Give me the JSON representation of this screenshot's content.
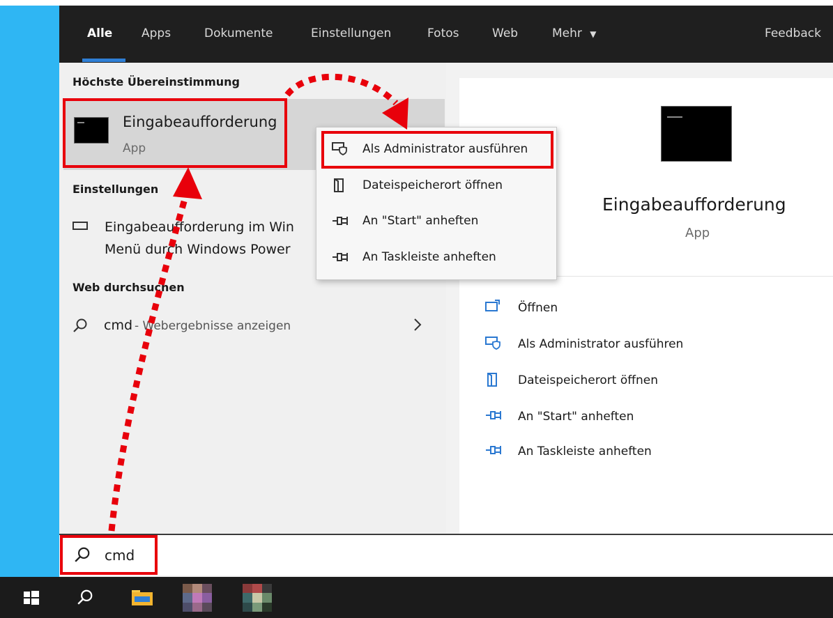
{
  "colors": {
    "accent": "#2f7fd6",
    "highlight": "#e8000b",
    "desktop": "#2fb6f3",
    "topbar": "#1f1f1f",
    "taskbar": "#1b1b1b"
  },
  "tabs": [
    {
      "label": "Alle",
      "active": true
    },
    {
      "label": "Apps"
    },
    {
      "label": "Dokumente"
    },
    {
      "label": "Einstellungen"
    },
    {
      "label": "Fotos"
    },
    {
      "label": "Web"
    },
    {
      "label": "Mehr"
    }
  ],
  "feedback_label": "Feedback",
  "left": {
    "best_match_heading": "Höchste Übereinstimmung",
    "best_match": {
      "title": "Eingabeaufforderung",
      "subtitle": "App",
      "icon": "command-prompt-icon"
    },
    "settings_heading": "Einstellungen",
    "settings_item": {
      "line1": "Eingabeaufforderung im Win",
      "line2": "Menü durch Windows Power",
      "icon": "monitor-icon"
    },
    "web_heading": "Web durchsuchen",
    "web_item": {
      "query": "cmd",
      "suffix": " - Webergebnisse anzeigen",
      "icon": "search-icon"
    }
  },
  "context_menu": {
    "items": [
      {
        "label": "Als Administrator ausführen",
        "icon": "run-as-admin-icon"
      },
      {
        "label": "Dateispeicherort öffnen",
        "icon": "file-location-icon"
      },
      {
        "label": "An \"Start\" anheften",
        "icon": "pin-icon"
      },
      {
        "label": "An Taskleiste anheften",
        "icon": "pin-icon"
      }
    ]
  },
  "preview": {
    "title": "Eingabeaufforderung",
    "subtitle": "App",
    "actions": [
      {
        "label": "Öffnen",
        "icon": "open-icon"
      },
      {
        "label": "Als Administrator ausführen",
        "icon": "run-as-admin-icon"
      },
      {
        "label": "Dateispeicherort öffnen",
        "icon": "file-location-icon"
      },
      {
        "label": "An \"Start\" anheften",
        "icon": "pin-icon"
      },
      {
        "label": "An Taskleiste anheften",
        "icon": "pin-icon"
      }
    ]
  },
  "search": {
    "value": "cmd",
    "icon": "search-icon"
  },
  "taskbar": {
    "items": [
      "windows-start-icon",
      "search-icon",
      "file-explorer-icon",
      "pixelated-app-icon",
      "pixelated-app-icon"
    ]
  }
}
